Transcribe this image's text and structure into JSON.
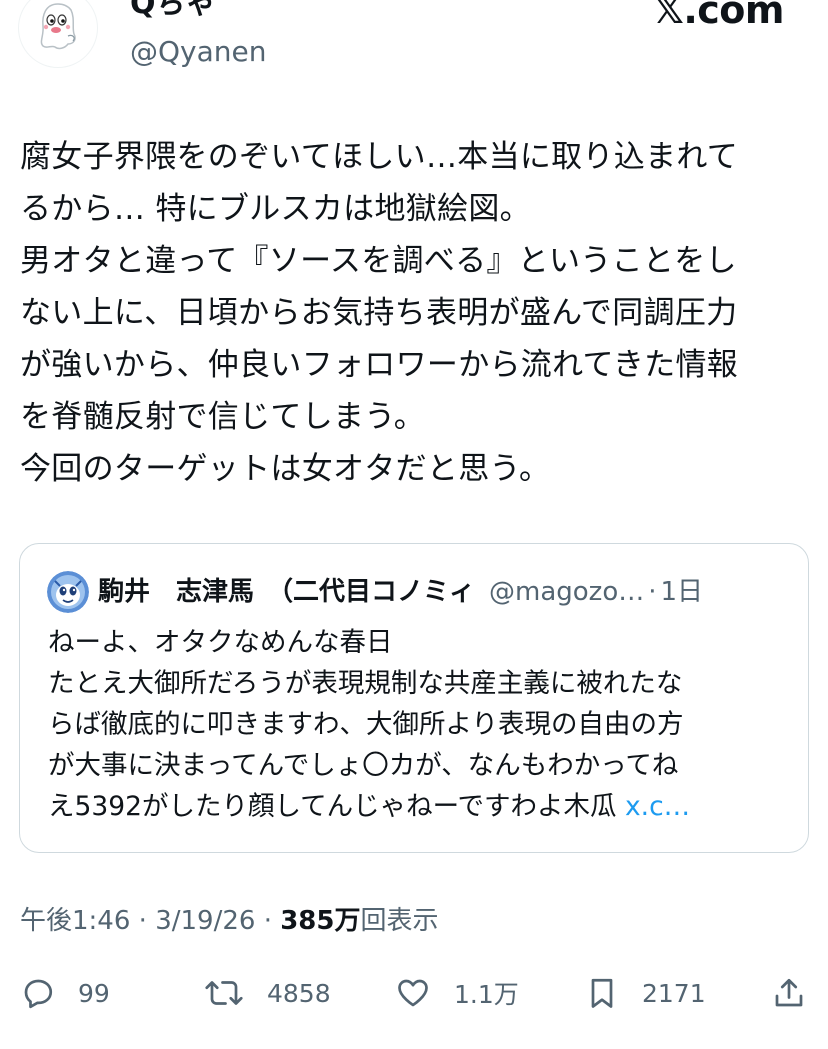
{
  "author": {
    "name": "Qちゃ",
    "handle": "@Qyanen",
    "avatar_icon": "ghost-avatar-icon"
  },
  "site_logo": "𝕏.com",
  "tweet": {
    "lines": [
      "腐女子界隈をのぞいてほしい…本当に取り込まれて",
      "るから… 特にブルスカは地獄絵図。",
      "男オタと違って『ソースを調べる』ということをし",
      "ない上に、日頃からお気持ち表明が盛んで同調圧力",
      "が強いから、仲良いフォロワーから流れてきた情報",
      "を脊髄反射で信じてしまう。",
      "今回のターゲットは女オタだと思う。"
    ]
  },
  "quoted": {
    "name": "駒井　志津馬　（二代目コノミィ",
    "handle": "@magozo…",
    "separator": "·",
    "time": "1日",
    "lines": [
      "ねーよ、オタクなめんな春日",
      "たとえ大御所だろうが表現規制な共産主義に被れたな",
      "らば徹底的に叩きますわ、大御所より表現の自由の方",
      "が大事に決まってんでしょ〇カが、なんもわかってね",
      "え5392がしたり顔してんじゃねーですわよ木瓜"
    ],
    "link_text": "x.c…"
  },
  "meta": {
    "time": "午後1:46",
    "sep1": "·",
    "date": "3/19/26",
    "sep2": "·",
    "views_count": "385万",
    "views_label": "回表示"
  },
  "actions": {
    "replies": "99",
    "reposts": "4858",
    "likes": "1.1万",
    "bookmarks": "2171"
  },
  "colors": {
    "text": "#0f1419",
    "secondary": "#536471",
    "link": "#1d9bf0",
    "border": "#cfd9de"
  }
}
